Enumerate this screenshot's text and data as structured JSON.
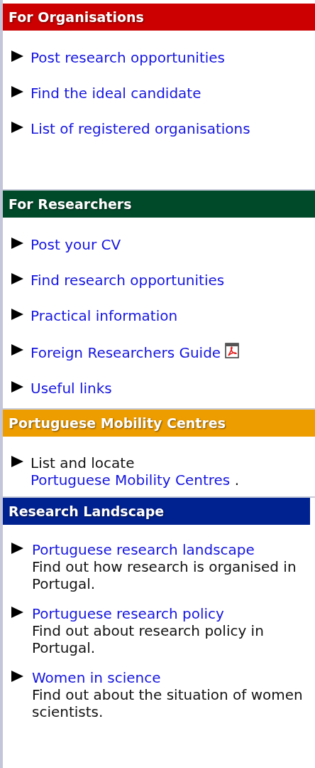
{
  "sections": [
    {
      "title": "For Organisations",
      "color": "#cc0000",
      "items": [
        {
          "kind": "link",
          "label": "Post research opportunities"
        },
        {
          "kind": "link",
          "label": "Find the ideal candidate"
        },
        {
          "kind": "link",
          "label": "List of registered organisations"
        }
      ]
    },
    {
      "title": "For Researchers",
      "color": "#004a2a",
      "items": [
        {
          "kind": "link",
          "label": "Post your CV"
        },
        {
          "kind": "link",
          "label": "Find research opportunities"
        },
        {
          "kind": "link",
          "label": "Practical information"
        },
        {
          "kind": "link",
          "label": "Foreign Researchers Guide",
          "pdf": true
        },
        {
          "kind": "link",
          "label": "Useful links"
        }
      ]
    },
    {
      "title": "Portuguese Mobility Centres",
      "color": "#ee9d00",
      "items": [
        {
          "kind": "mixed",
          "before": "List and locate",
          "link": "Portuguese Mobility Centres",
          "after": "."
        }
      ]
    },
    {
      "title": "Research Landscape",
      "color": "#002190",
      "items": [
        {
          "kind": "described",
          "label": "Portuguese research landscape",
          "description": "Find out how research is organised in Portugal."
        },
        {
          "kind": "described",
          "label": "Portuguese research policy",
          "description": "Find out about research policy in Portugal."
        },
        {
          "kind": "described",
          "label": "Women in science",
          "description": "Find out about the situation of women scientists."
        }
      ]
    }
  ]
}
